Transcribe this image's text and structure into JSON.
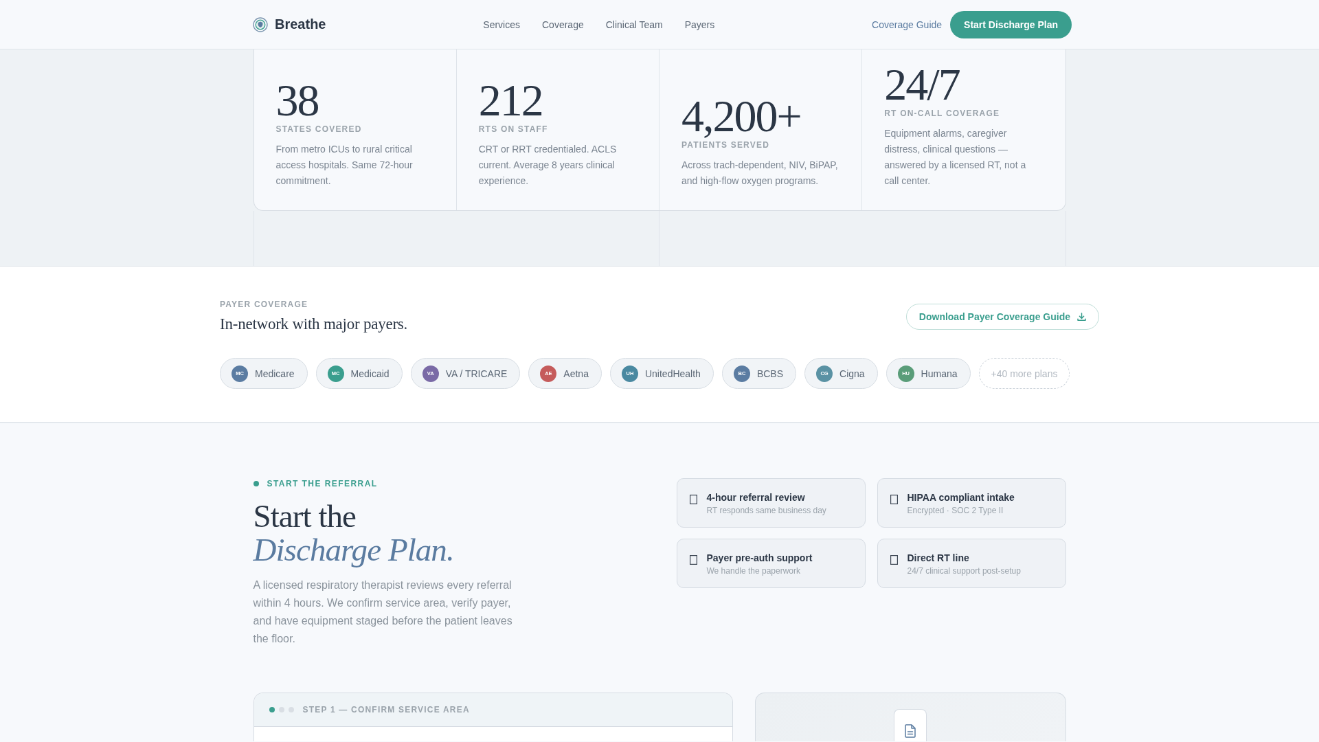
{
  "header": {
    "brand": "Breathe",
    "nav": [
      "Services",
      "Coverage",
      "Clinical Team",
      "Payers"
    ],
    "guide_link": "Coverage Guide",
    "cta_button": "Start Discharge Plan"
  },
  "stats": [
    {
      "value": "38",
      "label": "STATES COVERED",
      "description": "From metro ICUs to rural critical access hospitals. Same 72-hour commitment."
    },
    {
      "value": "212",
      "label": "RTS ON STAFF",
      "description": "CRT or RRT credentialed. ACLS current. Average 8 years clinical experience."
    },
    {
      "value": "4,200+",
      "label": "PATIENTS SERVED",
      "description": "Across trach-dependent, NIV, BiPAP, and high-flow oxygen programs."
    },
    {
      "value": "24/7",
      "label": "RT ON-CALL COVERAGE",
      "description": "Equipment alarms, caregiver distress, clinical questions — answered by a licensed RT, not a call center."
    }
  ],
  "payer_coverage": {
    "eyebrow": "PAYER COVERAGE",
    "heading": "In-network with major payers.",
    "download_button": "Download Payer Coverage Guide",
    "plans": [
      {
        "initials": "MC",
        "name": "Medicare",
        "color": "#5b7ca2"
      },
      {
        "initials": "MC",
        "name": "Medicaid",
        "color": "#3a9e8e"
      },
      {
        "initials": "VA",
        "name": "VA / TRICARE",
        "color": "#7a6aa6"
      },
      {
        "initials": "AE",
        "name": "Aetna",
        "color": "#c55b5b"
      },
      {
        "initials": "UH",
        "name": "UnitedHealth",
        "color": "#4a89a1"
      },
      {
        "initials": "BC",
        "name": "BCBS",
        "color": "#5b7ca2"
      },
      {
        "initials": "CG",
        "name": "Cigna",
        "color": "#5a92a4"
      },
      {
        "initials": "HU",
        "name": "Humana",
        "color": "#5a9d79"
      }
    ],
    "more_plans": "+40 more plans"
  },
  "referral": {
    "eyebrow": "START THE REFERRAL",
    "heading": "Start the *Discharge Plan.*",
    "body": "A licensed respiratory therapist reviews every referral within 4 hours. We confirm service area, verify payer, and have equipment staged before the patient leaves the floor.",
    "features": [
      {
        "title": "4-hour referral review",
        "subtitle": "RT responds same business day"
      },
      {
        "title": "HIPAA compliant intake",
        "subtitle": "Encrypted · SOC 2 Type II"
      },
      {
        "title": "Payer pre-auth support",
        "subtitle": "We handle the paperwork"
      },
      {
        "title": "Direct RT line",
        "subtitle": "24/7 clinical support post-setup"
      }
    ]
  },
  "step_card": {
    "progress": [
      {
        "selected": true
      },
      {
        "selected": false
      },
      {
        "selected": false
      }
    ],
    "title": "STEP 1 — CONFIRM SERVICE AREA"
  }
}
